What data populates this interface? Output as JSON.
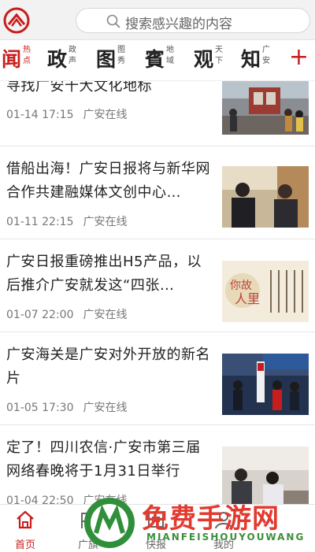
{
  "search": {
    "placeholder": "搜索感兴趣的内容"
  },
  "categories": [
    {
      "big": "闻",
      "small": "热点",
      "active": true
    },
    {
      "big": "政",
      "small": "政声"
    },
    {
      "big": "图",
      "small": "图秀"
    },
    {
      "big": "賓",
      "small": "地域"
    },
    {
      "big": "观",
      "small": "天下"
    },
    {
      "big": "知",
      "small": "广安"
    }
  ],
  "add_label": "+",
  "articles": [
    {
      "title": "寻找广安十大文化地标",
      "time": "01-14  17:15",
      "source": "广安在线"
    },
    {
      "title": "借船出海！广安日报将与新华网合作共建融媒体文创中心…",
      "time": "01-11  22:15",
      "source": "广安在线"
    },
    {
      "title": "广安日报重磅推出H5产品，以后推介广安就发这“四张…",
      "time": "01-07  22:00",
      "source": "广安在线"
    },
    {
      "title": "广安海关是广安对外开放的新名片",
      "time": "01-05  17:30",
      "source": "广安在线"
    },
    {
      "title": "定了！四川农信·广安市第三届网络春晚将于1月31日举行",
      "time": "01-04  22:50",
      "source": "广安在线"
    }
  ],
  "thumb_text": {
    "a3_line1": "你故",
    "a3_line2": "人里"
  },
  "bottom_tabs": [
    {
      "label": "首页",
      "active": true
    },
    {
      "label": "广旗"
    },
    {
      "label": "快报"
    },
    {
      "label": "我的"
    }
  ],
  "watermark": {
    "text": "免费手游网",
    "sub": "MIANFEISHOUYOUWANG"
  }
}
